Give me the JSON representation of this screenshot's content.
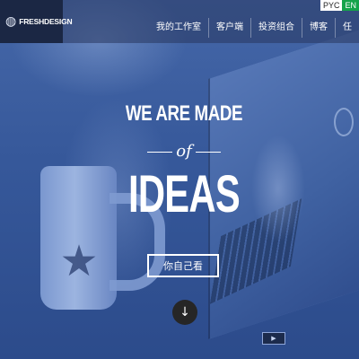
{
  "brand": {
    "logo_text": "FRESHDESIGN",
    "logo_icon": "globe-icon"
  },
  "language": {
    "ru": "PYC",
    "en": "EN"
  },
  "nav": {
    "items": [
      {
        "label": "我的工作室"
      },
      {
        "label": "客户端"
      },
      {
        "label": "投资组合"
      },
      {
        "label": "博客"
      },
      {
        "label": "任"
      }
    ]
  },
  "hero": {
    "headline_top": "WE ARE MADE",
    "connector": "of",
    "headline_main": "IDEAS",
    "cta_label": "你自己看",
    "scroll_icon": "↓"
  },
  "colors": {
    "overlay": "#2f4f8e",
    "lang_en": "#15a34a",
    "logo_bg": "#1b2744"
  }
}
